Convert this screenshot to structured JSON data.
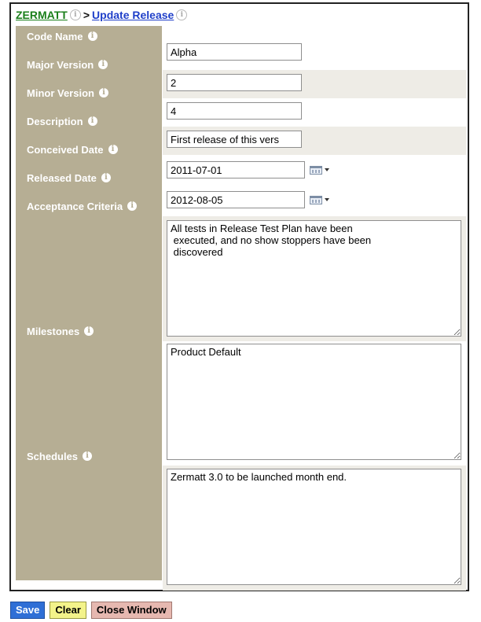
{
  "breadcrumb": {
    "root": "ZERMATT",
    "separator": ">",
    "page": "Update Release"
  },
  "fields": {
    "code_name": {
      "label": "Code Name",
      "value": "Alpha"
    },
    "major_version": {
      "label": "Major Version",
      "value": "2"
    },
    "minor_version": {
      "label": "Minor Version",
      "value": "4"
    },
    "description": {
      "label": "Description",
      "value": "First release of this vers"
    },
    "conceived_date": {
      "label": "Conceived Date",
      "value": "2011-07-01"
    },
    "released_date": {
      "label": "Released Date",
      "value": "2012-08-05"
    },
    "acceptance_criteria": {
      "label": "Acceptance Criteria",
      "value": "All tests in Release Test Plan have been\n executed, and no show stoppers have been\n discovered"
    },
    "milestones": {
      "label": "Milestones",
      "value": "Product Default"
    },
    "schedules": {
      "label": "Schedules",
      "value": "Zermatt 3.0 to be launched month end."
    }
  },
  "buttons": {
    "save": "Save",
    "clear": "Clear",
    "close": "Close Window"
  },
  "icons": {
    "info": "info-icon",
    "calendar": "calendar-icon"
  },
  "colors": {
    "label_column": "#b6ae94",
    "alt_row": "#eeece6",
    "breadcrumb_root": "#1a7f1a",
    "breadcrumb_page": "#1f3fc9",
    "save_button": "#2f6fd6",
    "clear_button": "#f3f38a",
    "close_button": "#e6b8b0"
  }
}
